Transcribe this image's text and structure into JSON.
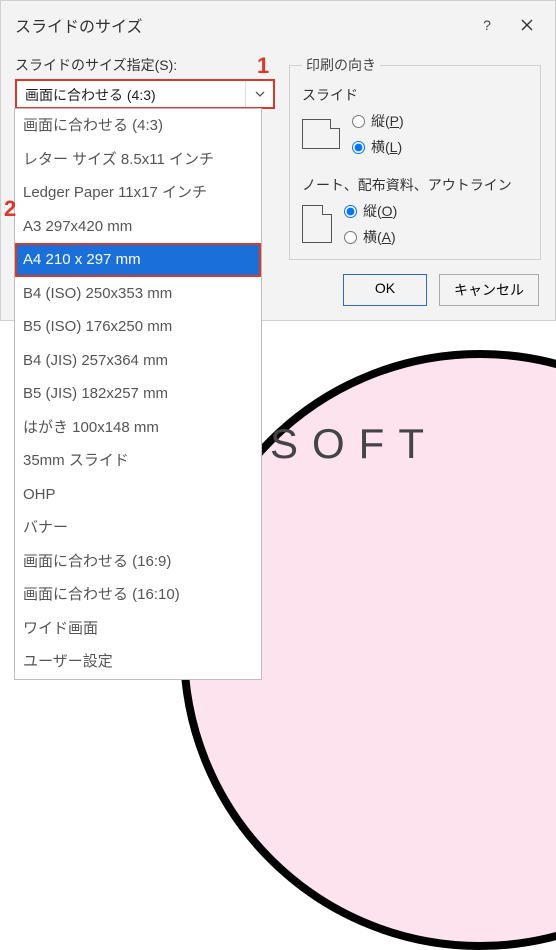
{
  "titlebar": {
    "title": "スライドのサイズ"
  },
  "left": {
    "label": "スライドのサイズ指定(S):",
    "combo_value": "画面に合わせる (4:3)"
  },
  "markers": {
    "one": "1",
    "two": "2"
  },
  "dropdown": {
    "items": [
      "画面に合わせる (4:3)",
      "レター サイズ 8.5x11 インチ",
      "Ledger Paper 11x17 インチ",
      "A3 297x420 mm",
      "A4 210 x 297 mm",
      "B4 (ISO) 250x353 mm",
      "B5 (ISO) 176x250 mm",
      "B4 (JIS) 257x364 mm",
      "B5 (JIS) 182x257 mm",
      "はがき 100x148 mm",
      "35mm スライド",
      "OHP",
      "バナー",
      "画面に合わせる (16:9)",
      "画面に合わせる (16:10)",
      "ワイド画面",
      "ユーザー設定"
    ],
    "selected_index": 4
  },
  "orientation": {
    "legend": "印刷の向き",
    "slides_label": "スライド",
    "notes_label": "ノート、配布資料、アウトライン",
    "portrait": "縦(",
    "landscape": "横(",
    "accel": {
      "P": "P",
      "L": "L",
      "O": "O",
      "A": "A"
    },
    "close_paren": ")"
  },
  "buttons": {
    "ok": "OK",
    "cancel": "キャンセル"
  },
  "background_text": "SOFT"
}
